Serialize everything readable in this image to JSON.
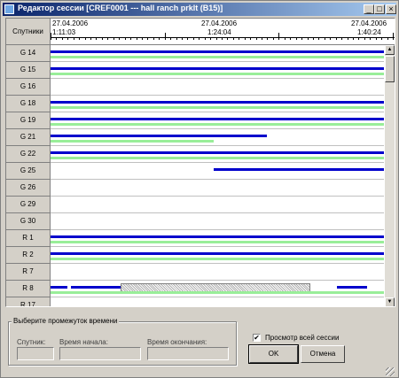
{
  "window": {
    "title": "Редактор сессии [CREF0001 --- hall ranch prklt (B15)]",
    "minimize_label": "_",
    "maximize_label": "□",
    "close_label": "×"
  },
  "timeline": {
    "satellites_header": "Спутники",
    "ruler": [
      {
        "date": "27.04.2006",
        "time": "1:11:03"
      },
      {
        "date": "27.04.2006",
        "time": "1:24:04"
      },
      {
        "date": "27.04.2006",
        "time": "1:40:24"
      }
    ],
    "rows": [
      {
        "name": "G 14",
        "bars": [
          {
            "kind": "blue",
            "start": 0.0,
            "end": 1.0
          },
          {
            "kind": "green",
            "start": 0.0,
            "end": 1.0
          }
        ]
      },
      {
        "name": "G 15",
        "bars": [
          {
            "kind": "blue",
            "start": 0.0,
            "end": 1.0
          },
          {
            "kind": "green",
            "start": 0.0,
            "end": 1.0
          }
        ]
      },
      {
        "name": "G 16",
        "bars": []
      },
      {
        "name": "G 18",
        "bars": [
          {
            "kind": "blue",
            "start": 0.0,
            "end": 1.0
          },
          {
            "kind": "green",
            "start": 0.0,
            "end": 1.0
          }
        ]
      },
      {
        "name": "G 19",
        "bars": [
          {
            "kind": "blue",
            "start": 0.0,
            "end": 1.0
          },
          {
            "kind": "green",
            "start": 0.0,
            "end": 1.0
          }
        ]
      },
      {
        "name": "G 21",
        "bars": [
          {
            "kind": "blue",
            "start": 0.0,
            "end": 0.65
          },
          {
            "kind": "green",
            "start": 0.0,
            "end": 0.49
          }
        ]
      },
      {
        "name": "G 22",
        "bars": [
          {
            "kind": "blue",
            "start": 0.0,
            "end": 1.0
          },
          {
            "kind": "green",
            "start": 0.0,
            "end": 1.0
          }
        ]
      },
      {
        "name": "G 25",
        "bars": [
          {
            "kind": "blue",
            "start": 0.49,
            "end": 1.0
          }
        ]
      },
      {
        "name": "G 26",
        "bars": []
      },
      {
        "name": "G 29",
        "bars": []
      },
      {
        "name": "G 30",
        "bars": []
      },
      {
        "name": "R 1",
        "bars": [
          {
            "kind": "blue",
            "start": 0.0,
            "end": 1.0
          },
          {
            "kind": "green",
            "start": 0.0,
            "end": 1.0
          }
        ]
      },
      {
        "name": "R 2",
        "bars": [
          {
            "kind": "blue",
            "start": 0.0,
            "end": 1.0
          },
          {
            "kind": "green",
            "start": 0.0,
            "end": 1.0
          }
        ]
      },
      {
        "name": "R 7",
        "bars": []
      },
      {
        "name": "R 8",
        "bars": [
          {
            "kind": "blue",
            "start": 0.0,
            "end": 0.05
          },
          {
            "kind": "blue",
            "start": 0.06,
            "end": 0.21
          },
          {
            "kind": "blue",
            "start": 0.25,
            "end": 0.42
          },
          {
            "kind": "blue",
            "start": 0.53,
            "end": 0.61
          },
          {
            "kind": "blue",
            "start": 0.67,
            "end": 0.78
          },
          {
            "kind": "blue",
            "start": 0.86,
            "end": 0.95
          },
          {
            "kind": "hatch",
            "start": 0.21,
            "end": 0.78
          },
          {
            "kind": "green",
            "start": 0.0,
            "end": 1.0
          }
        ]
      },
      {
        "name": "R 17",
        "bars": [
          {
            "kind": "green",
            "start": 0.0,
            "end": 1.0
          }
        ]
      },
      {
        "name": "R 22",
        "bars": []
      }
    ]
  },
  "selection": {
    "group_title": "Выберите промежуток времени",
    "satellite_label": "Спутник:",
    "start_label": "Время начала:",
    "end_label": "Время окончания:",
    "satellite_value": "",
    "start_value": "",
    "end_value": ""
  },
  "options": {
    "view_all_label": "Просмотр всей сессии",
    "view_all_checked": true,
    "checkmark": "✔"
  },
  "buttons": {
    "ok_label": "OK",
    "cancel_label": "Отмена"
  },
  "scrollbar": {
    "up_arrow": "▲",
    "down_arrow": "▼"
  },
  "colors": {
    "blue_track": "#0000cc",
    "green_track": "#99ee99",
    "title_bar": "#0a246a"
  }
}
